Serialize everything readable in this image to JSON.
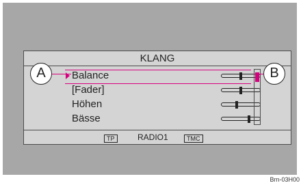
{
  "screen": {
    "title": "KLANG",
    "items": [
      {
        "label": "Balance",
        "level": 0.5
      },
      {
        "label": "[Fader]",
        "level": 0.5
      },
      {
        "label": "Höhen",
        "level": 0.38
      },
      {
        "label": "Bässe",
        "level": 0.72
      }
    ],
    "selected_index": 0,
    "status": {
      "tp": "TP",
      "source": "RADIO1",
      "tmc": "TMC"
    }
  },
  "callouts": {
    "a": "A",
    "b": "B"
  },
  "figure_id": "Brn-03H00",
  "colors": {
    "highlight": "#d6007e",
    "bezel": "#a7a7a7",
    "screen": "#d4d4d4"
  }
}
